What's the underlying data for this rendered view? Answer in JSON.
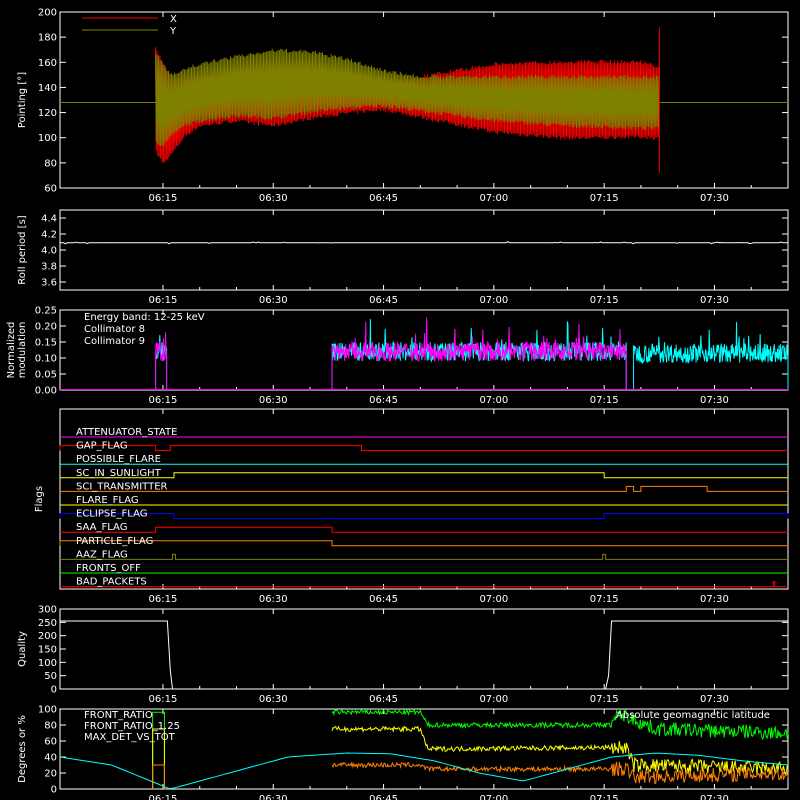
{
  "time_ticks": [
    "06:15",
    "06:30",
    "06:45",
    "07:00",
    "07:15",
    "07:30"
  ],
  "time_tick_minutes": [
    375,
    390,
    405,
    420,
    435,
    450
  ],
  "time_range_minutes": [
    361,
    460
  ],
  "colors": {
    "x_series": "#ff0000",
    "y_series": "#808000",
    "white": "#ffffff",
    "cyan": "#00ffff",
    "magenta": "#ff00ff",
    "yellow": "#ffff00",
    "green": "#00ff00",
    "orange": "#ff8000",
    "blue": "#0000ff",
    "red": "#ff0000"
  },
  "chart_data": [
    {
      "panel": "pointing",
      "type": "line",
      "ylabel": "Pointing [°]",
      "ylim": [
        60,
        200
      ],
      "yticks": [
        60,
        80,
        100,
        120,
        140,
        160,
        180,
        200
      ],
      "series": [
        {
          "name": "X",
          "color": "#ff0000",
          "baseline": 128,
          "x": [
            374,
            375,
            376,
            378,
            380,
            385,
            390,
            395,
            400,
            405,
            410,
            420,
            430,
            440,
            442.5
          ],
          "upper": [
            172,
            162,
            150,
            148,
            150,
            155,
            160,
            159,
            152,
            146,
            150,
            160,
            162,
            162,
            158
          ],
          "lower": [
            88,
            78,
            84,
            100,
            108,
            112,
            108,
            114,
            118,
            121,
            115,
            103,
            98,
            99,
            98
          ]
        },
        {
          "name": "Y",
          "color": "#808000",
          "baseline": 128,
          "x": [
            374,
            375,
            376,
            378,
            380,
            385,
            390,
            395,
            400,
            405,
            410,
            420,
            430,
            440,
            442.5
          ],
          "upper": [
            168,
            160,
            152,
            156,
            160,
            166,
            171,
            170,
            164,
            155,
            150,
            150,
            150,
            150,
            150
          ],
          "lower": [
            96,
            92,
            100,
            108,
            112,
            116,
            114,
            119,
            122,
            124,
            120,
            112,
            108,
            106,
            106
          ]
        }
      ]
    },
    {
      "panel": "roll_period",
      "type": "line",
      "ylabel": "Roll period [s]",
      "ylim": [
        3.5,
        4.5
      ],
      "yticks": [
        3.6,
        3.8,
        4.0,
        4.2,
        4.4
      ],
      "series": [
        {
          "name": "",
          "color": "#ffffff",
          "x": [
            361,
            460
          ],
          "y": [
            4.09,
            4.09
          ]
        }
      ]
    },
    {
      "panel": "modulation",
      "type": "line",
      "ylabel": "Normalized modulation",
      "ylim": [
        0,
        0.25
      ],
      "yticks": [
        0.0,
        0.05,
        0.1,
        0.15,
        0.2,
        0.25
      ],
      "annotation": "Energy band: 12-25 keV",
      "series": [
        {
          "name": "Collimator 8",
          "color": "#00ffff",
          "segments": [
            {
              "x": [
                374,
                375.5
              ],
              "y": 0.115
            },
            {
              "x": [
                398,
                438
              ],
              "y": 0.12
            },
            {
              "x": [
                439,
                460
              ],
              "y": 0.115
            }
          ]
        },
        {
          "name": "Collimator 9",
          "color": "#ff00ff",
          "segments": [
            {
              "x": [
                374,
                375.5
              ],
              "y": 0.12
            },
            {
              "x": [
                398,
                438
              ],
              "y": 0.12
            }
          ]
        }
      ]
    },
    {
      "panel": "flags",
      "type": "line",
      "ylabel": "Flags",
      "flags": [
        {
          "name": "ATTENUATOR_STATE",
          "color": "#ff00ff",
          "high": []
        },
        {
          "name": "GAP_FLAG",
          "color": "#ff0000",
          "high": [
            [
              361,
              374
            ],
            [
              376,
              402
            ]
          ]
        },
        {
          "name": "POSSIBLE_FLARE",
          "color": "#00ffff",
          "high": []
        },
        {
          "name": "SC_IN_SUNLIGHT",
          "color": "#ffff00",
          "high": [
            [
              376.5,
              435
            ]
          ]
        },
        {
          "name": "SCI_TRANSMITTER",
          "color": "#ff8000",
          "high": [
            [
              438,
              439
            ],
            [
              440,
              449
            ]
          ]
        },
        {
          "name": "FLARE_FLAG",
          "color": "#ffff00",
          "high": []
        },
        {
          "name": "ECLIPSE_FLAG",
          "color": "#0000ff",
          "high": [
            [
              361,
              376.5
            ],
            [
              435,
              460
            ]
          ]
        },
        {
          "name": "SAA_FLAG",
          "color": "#ff0000",
          "high": [
            [
              374,
              398
            ]
          ]
        },
        {
          "name": "PARTICLE_FLAG",
          "color": "#ff8000",
          "high": [
            [
              361,
              398
            ]
          ]
        },
        {
          "name": "AAZ_FLAG",
          "color": "#808000",
          "high": [
            [
              376.3,
              376.7
            ],
            [
              434.8,
              435.2
            ]
          ]
        },
        {
          "name": "FRONTS_OFF",
          "color": "#00ff00",
          "high": []
        },
        {
          "name": "BAD_PACKETS",
          "color": "#ff0000",
          "high": [
            [
              458,
              458.2
            ]
          ]
        }
      ]
    },
    {
      "panel": "quality",
      "type": "line",
      "ylabel": "Quality",
      "ylim": [
        0,
        300
      ],
      "yticks": [
        0,
        50,
        100,
        150,
        200,
        250,
        300
      ],
      "series": [
        {
          "name": "",
          "color": "#ffffff",
          "x": [
            361,
            375.6,
            376,
            376.3,
            435.2,
            435.6,
            436,
            460
          ],
          "y": [
            255,
            255,
            70,
            0,
            0,
            50,
            255,
            255
          ]
        }
      ]
    },
    {
      "panel": "front_ratio",
      "type": "line",
      "ylabel": "Degrees or %",
      "ylim": [
        0,
        100
      ],
      "yticks": [
        0,
        20,
        40,
        60,
        80,
        100
      ],
      "annotation": "Absolute geomagnetic latitude",
      "series": [
        {
          "name": "FRONT_RATIO",
          "color": "#ffff00",
          "x": [
            398,
            410,
            411,
            438,
            439,
            460
          ],
          "y": [
            75,
            75,
            50,
            52,
            30,
            25
          ]
        },
        {
          "name": "FRONT_RATIO_1.25",
          "color": "#00ff00",
          "x": [
            398,
            410,
            411,
            436,
            437,
            442,
            460
          ],
          "y": [
            96,
            96,
            80,
            80,
            95,
            75,
            70
          ]
        },
        {
          "name": "MAX_DET_VS_TOT",
          "color": "#ff8000",
          "x": [
            398,
            410,
            411,
            438,
            439,
            460
          ],
          "y": [
            30,
            30,
            25,
            25,
            15,
            20
          ]
        },
        {
          "name": "",
          "color": "#00ffff",
          "x": [
            361,
            368,
            376,
            384,
            392,
            400,
            406,
            412,
            418,
            424,
            430,
            436,
            442,
            448,
            454,
            460
          ],
          "y": [
            40,
            30,
            0,
            20,
            40,
            45,
            44,
            35,
            20,
            10,
            25,
            40,
            45,
            42,
            35,
            30
          ]
        }
      ]
    }
  ]
}
